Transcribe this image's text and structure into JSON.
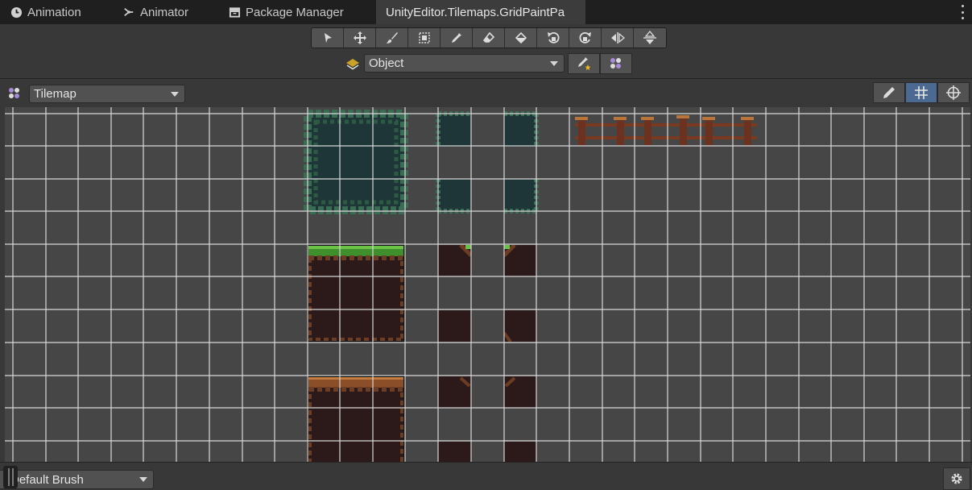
{
  "tabs": [
    {
      "label": "Animation",
      "icon": "clock-icon"
    },
    {
      "label": "Animator",
      "icon": "animator-graph-icon"
    },
    {
      "label": "Package Manager",
      "icon": "package-icon"
    },
    {
      "label": "UnityEditor.Tilemaps.GridPaintPa",
      "icon": "",
      "active": true
    }
  ],
  "toolbar": {
    "tools": [
      "select-tool",
      "move-tool",
      "paint-brush-tool",
      "box-fill-tool",
      "picker-tool",
      "eraser-tool",
      "flood-fill-tool",
      "rotate-counterclockwise-tool",
      "rotate-clockwise-tool",
      "flip-x-tool",
      "flip-y-tool"
    ],
    "active_target": "Object"
  },
  "palette": {
    "selected": "Tilemap",
    "view_buttons": [
      "edit-pencil-icon",
      "grid-icon",
      "gizmo-icon"
    ],
    "active_view": "grid-icon"
  },
  "footer": {
    "brush": "Default Brush"
  },
  "colors": {
    "tabbar": "#1f1f1f",
    "panel": "#383838",
    "canvas": "#464646",
    "grid_line": "#d8d8d8",
    "active_toggle": "#4a6a92"
  }
}
